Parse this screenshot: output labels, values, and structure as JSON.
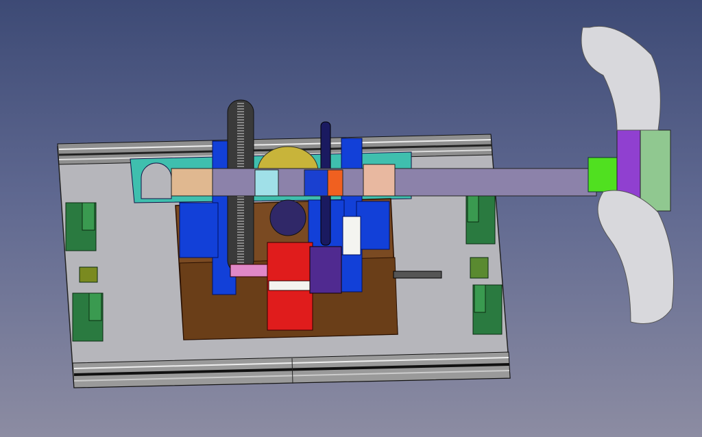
{
  "viewport": {
    "background_top": "#3d4a75",
    "background_bottom": "#8c8ca2"
  },
  "model_colors": {
    "base_plate": "#b4b4b8",
    "rail": "#9a9a9a",
    "platform": "#7a4a20",
    "bearing_block": "#1040d0",
    "gear": "#3c3c3c",
    "shaft": "#8c82a8",
    "motor": "#e02020",
    "clamp": "#2a7a40",
    "handle": "#d8d8d8",
    "hub": "#9040d0",
    "coupling_green": "#50e020",
    "teal_bracket": "#40c0b0"
  }
}
